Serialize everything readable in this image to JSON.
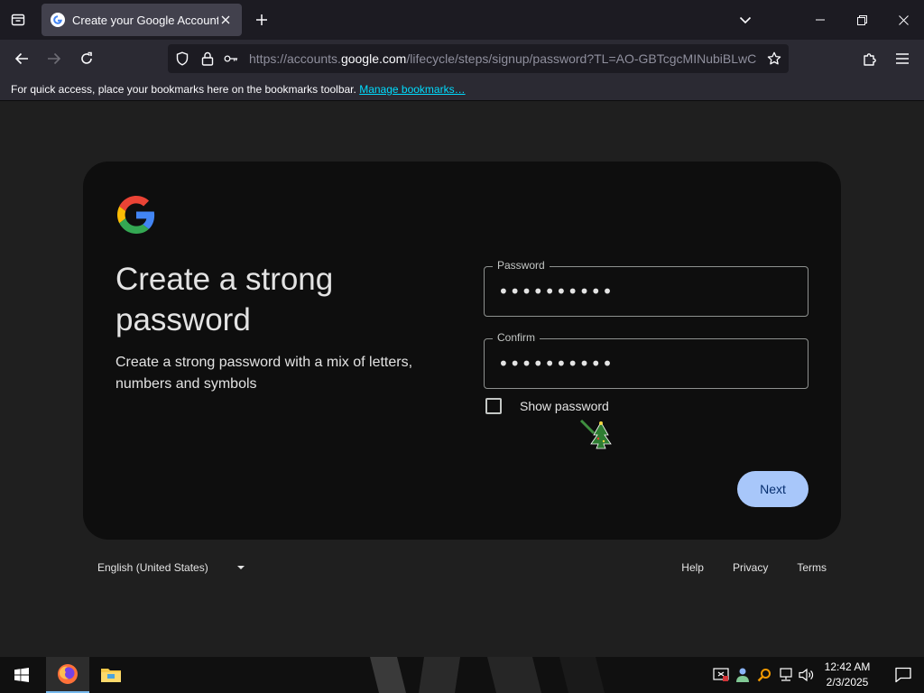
{
  "browser": {
    "tab": {
      "title": "Create your Google Account"
    },
    "url": {
      "prefix": "https://accounts.",
      "host": "google.com",
      "path": "/lifecycle/steps/signup/password?TL=AO-GBTcgcMINubiBLwCVS"
    },
    "bookmarks_bar": {
      "text": "For quick access, place your bookmarks here on the bookmarks toolbar.",
      "link": "Manage bookmarks…"
    }
  },
  "page": {
    "title": "Create a strong password",
    "subtitle": "Create a strong password with a mix of letters, numbers and symbols",
    "password": {
      "label": "Password",
      "value": "xxxxxxxxxx"
    },
    "confirm": {
      "label": "Confirm",
      "value": "xxxxxxxxxx"
    },
    "show_password_label": "Show password",
    "next_label": "Next"
  },
  "footer": {
    "language": "English (United States)",
    "links": [
      "Help",
      "Privacy",
      "Terms"
    ]
  },
  "taskbar": {
    "time": "12:42 AM",
    "date": "2/3/2025",
    "apps": [
      "firefox-icon",
      "file-explorer-icon"
    ]
  },
  "colors": {
    "page_bg": "#1f1f1f",
    "card_bg": "#0e0e0e",
    "primary_button": "#a8c7fa",
    "link_cyan": "#00ddff"
  }
}
